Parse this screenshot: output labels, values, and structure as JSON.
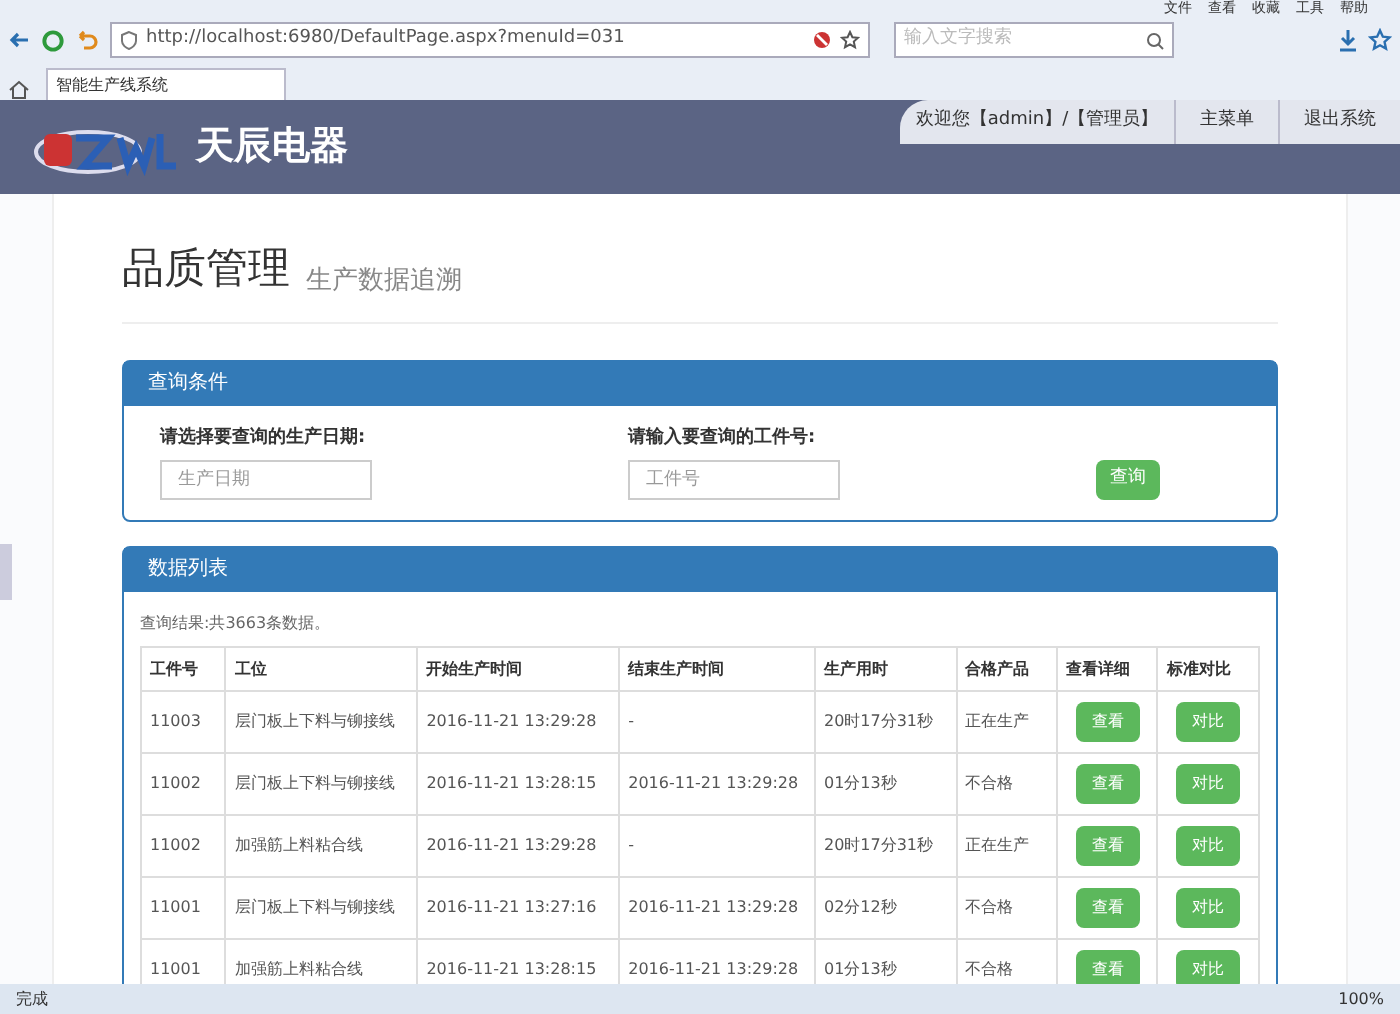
{
  "browser": {
    "menu": [
      "文件",
      "查看",
      "收藏",
      "工具",
      "帮助"
    ],
    "address": "http://localhost:6980/DefaultPage.aspx?menuId=031",
    "search_placeholder": "输入文字搜索",
    "tab_title": "智能生产线系统"
  },
  "header": {
    "brand": "天辰电器",
    "welcome": "欢迎您【admin】/【管理员】",
    "links": [
      "主菜单",
      "退出系统"
    ]
  },
  "page_title": "品质管理",
  "page_subtitle": "生产数据追溯",
  "query_panel": {
    "title": "查询条件",
    "date_label": "请选择要查询的生产日期:",
    "date_placeholder": "生产日期",
    "job_label": "请输入要查询的工件号:",
    "job_placeholder": "工件号",
    "button": "查询"
  },
  "data_panel": {
    "title": "数据列表",
    "summary": "查询结果:共3663条数据。",
    "table": {
      "columns": [
        "工件号",
        "工位",
        "开始生产时间",
        "结束生产时间",
        "生产用时",
        "合格产品",
        "查看详细",
        "标准对比"
      ],
      "rows": [
        {
          "id": "11003",
          "station": "层门板上下料与铆接线",
          "start": "2016-11-21 13:29:28",
          "end": "-",
          "duration": "20时17分31秒",
          "result": "正在生产",
          "view": "查看",
          "compare": "对比"
        },
        {
          "id": "11002",
          "station": "层门板上下料与铆接线",
          "start": "2016-11-21 13:28:15",
          "end": "2016-11-21 13:29:28",
          "duration": "01分13秒",
          "result": "不合格",
          "view": "查看",
          "compare": "对比"
        },
        {
          "id": "11002",
          "station": "加强筋上料粘合线",
          "start": "2016-11-21 13:29:28",
          "end": "-",
          "duration": "20时17分31秒",
          "result": "正在生产",
          "view": "查看",
          "compare": "对比"
        },
        {
          "id": "11001",
          "station": "层门板上下料与铆接线",
          "start": "2016-11-21 13:27:16",
          "end": "2016-11-21 13:29:28",
          "duration": "02分12秒",
          "result": "不合格",
          "view": "查看",
          "compare": "对比"
        },
        {
          "id": "11001",
          "station": "加强筋上料粘合线",
          "start": "2016-11-21 13:28:15",
          "end": "2016-11-21 13:29:28",
          "duration": "01分13秒",
          "result": "不合格",
          "view": "查看",
          "compare": "对比"
        }
      ]
    }
  },
  "status_bar": {
    "text": "完成",
    "zoom": "100%"
  }
}
